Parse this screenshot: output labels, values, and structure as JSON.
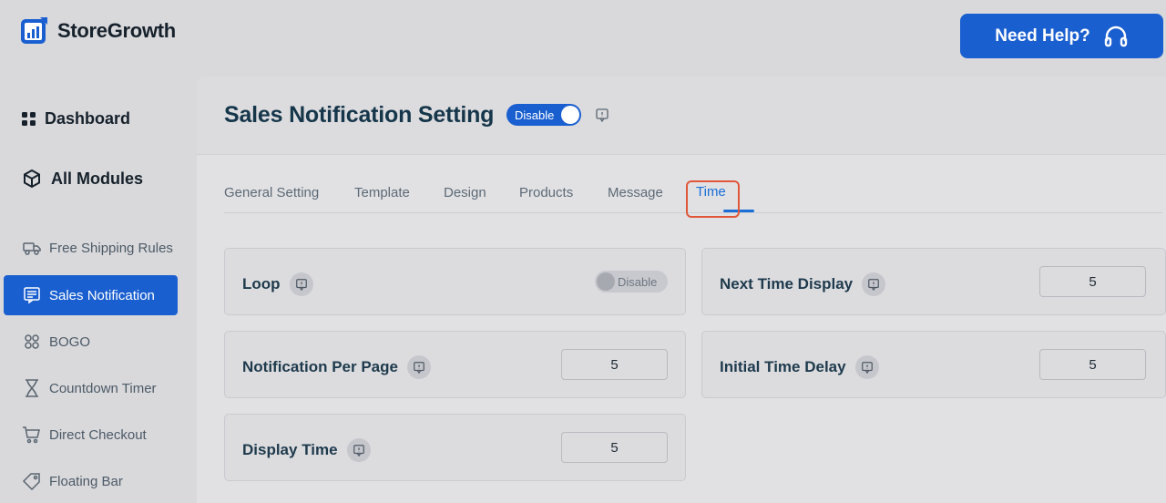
{
  "header": {
    "logo_text": "StoreGrowth",
    "help_label": "Need Help?"
  },
  "sidebar": {
    "main": [
      {
        "label": "Dashboard",
        "icon": "grid-icon"
      },
      {
        "label": "All Modules",
        "icon": "cube-icon"
      }
    ],
    "items": [
      {
        "label": "Free Shipping Rules",
        "icon": "truck-icon"
      },
      {
        "label": "Sales Notification",
        "icon": "notification-icon",
        "active": true
      },
      {
        "label": "BOGO",
        "icon": "bogo-icon"
      },
      {
        "label": "Countdown Timer",
        "icon": "hourglass-icon"
      },
      {
        "label": "Direct Checkout",
        "icon": "cart-icon"
      },
      {
        "label": "Floating Bar",
        "icon": "tag-icon"
      }
    ]
  },
  "page": {
    "title": "Sales Notification Setting",
    "toggle_label": "Disable"
  },
  "tabs": [
    {
      "label": "General Setting"
    },
    {
      "label": "Template"
    },
    {
      "label": "Design"
    },
    {
      "label": "Products"
    },
    {
      "label": "Message"
    },
    {
      "label": "Time",
      "active": true
    }
  ],
  "settings": {
    "loop": {
      "label": "Loop",
      "toggle_label": "Disable"
    },
    "next_time_display": {
      "label": "Next Time Display",
      "value": "5"
    },
    "notification_per_page": {
      "label": "Notification Per Page",
      "value": "5"
    },
    "initial_time_delay": {
      "label": "Initial Time Delay",
      "value": "5"
    },
    "display_time": {
      "label": "Display Time",
      "value": "5"
    }
  },
  "colors": {
    "accent": "#1a5fd0",
    "highlight": "#e0573a"
  }
}
